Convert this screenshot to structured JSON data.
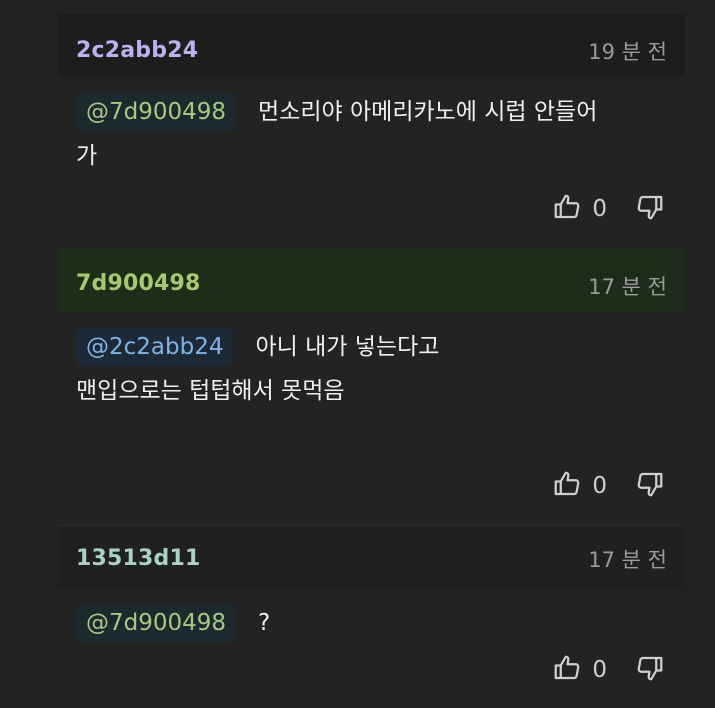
{
  "comments": [
    {
      "author": "2c2abb24",
      "time": "19 분 전",
      "mention": "@7d900498",
      "text_line1": "먼소리야 아메리카노에 시럽 안들어",
      "text_line2": "가",
      "like_count": "0"
    },
    {
      "author": "7d900498",
      "time": "17 분 전",
      "mention": "@2c2abb24",
      "text_line1": "아니 내가 넣는다고",
      "text_line2": "맨입으로는 텁텁해서 못먹음",
      "like_count": "0"
    },
    {
      "author": "13513d11",
      "time": "17 분 전",
      "mention": "@7d900498",
      "text_line1": "?",
      "like_count": "0"
    }
  ],
  "icons": {
    "like": "thumbs-up-icon",
    "dislike": "thumbs-down-icon"
  },
  "colors": {
    "background": "#232323",
    "highlight_header": "#1e2c1a",
    "author1": "#b9b3f2",
    "author2": "#a7c96d",
    "author3": "#a9d2c4",
    "mention_blue": "#7fb3e6",
    "mention_green": "#a9c87f"
  }
}
